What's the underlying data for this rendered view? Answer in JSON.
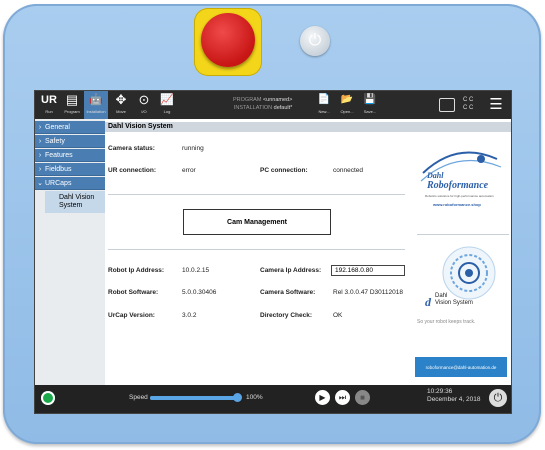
{
  "topbar": {
    "buttons": [
      {
        "icon": "UR",
        "label": "Run"
      },
      {
        "icon": "▤",
        "label": "Program"
      },
      {
        "icon": "🤖",
        "label": "Installation"
      },
      {
        "icon": "✥",
        "label": "Move"
      },
      {
        "icon": "⊙",
        "label": "I/O"
      },
      {
        "icon": "📈",
        "label": "Log"
      }
    ],
    "program_label": "PROGRAM",
    "program_value": "<unnamed>",
    "installation_label": "INSTALLATION",
    "installation_value": "default*",
    "file_buttons": [
      {
        "icon": "📄",
        "label": "New..."
      },
      {
        "icon": "📂",
        "label": "Open..."
      },
      {
        "icon": "💾",
        "label": "Save..."
      }
    ],
    "cc_text": "C C\nC C"
  },
  "sidebar": {
    "items": [
      {
        "label": "General",
        "chevron": "›"
      },
      {
        "label": "Safety",
        "chevron": "›"
      },
      {
        "label": "Features",
        "chevron": "›"
      },
      {
        "label": "Fieldbus",
        "chevron": "›"
      },
      {
        "label": "URCaps",
        "chevron": "⌄"
      }
    ],
    "sub_item": "Dahl Vision System"
  },
  "main": {
    "title": "Dahl Vision System",
    "camera_status_label": "Camera status:",
    "camera_status_value": "running",
    "ur_connection_label": "UR connection:",
    "ur_connection_value": "error",
    "pc_connection_label": "PC connection:",
    "pc_connection_value": "connected",
    "cam_management_button": "Cam Management",
    "robot_ip_label": "Robot Ip Address:",
    "robot_ip_value": "10.0.2.15",
    "camera_ip_label": "Camera Ip Address:",
    "camera_ip_value": "192.168.0.80",
    "robot_software_label": "Robot Software:",
    "robot_software_value": "5.0.0.30406",
    "camera_software_label": "Camera Software:",
    "camera_software_value": "Rel 3.0.0.47  D30112018",
    "urcap_version_label": "UrCap Version:",
    "urcap_version_value": "3.0.2",
    "directory_check_label": "Directory Check:",
    "directory_check_value": "OK"
  },
  "branding": {
    "logo_small": "Dahl",
    "logo_big": "Roboformance",
    "tagline": "Robotics solutions for high-performance automation",
    "website": "www.roboformance.shop",
    "vision_d": "d",
    "vision_line1": "Dahl",
    "vision_line2": "Vision System",
    "vision_tagline": "So your robot keeps track.",
    "email_button": "roboformance@dahl-automation.de"
  },
  "bottombar": {
    "speed_label": "Speed",
    "speed_value": "100%",
    "speed_fraction": 1.0,
    "time": "10:29:36",
    "date": "December 4, 2018"
  },
  "colors": {
    "accent": "#4a7eb3",
    "estop": "#c81515",
    "estop_base": "#f3d619",
    "status_green": "#1ca94c"
  }
}
